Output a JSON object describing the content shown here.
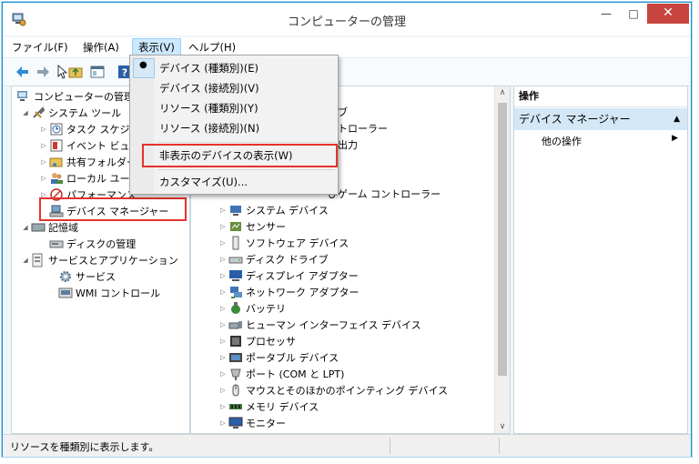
{
  "window": {
    "title": "コンピューターの管理"
  },
  "menubar": [
    {
      "label": "ファイル(F)"
    },
    {
      "label": "操作(A)"
    },
    {
      "label": "表示(V)"
    },
    {
      "label": "ヘルプ(H)"
    }
  ],
  "tree": {
    "root": "コンピューターの管理",
    "system_tools": "システム ツール",
    "task_scheduler": "タスク スケジュ",
    "event_viewer": "イベント ビュー",
    "shared_folders": "共有フォルダー",
    "local_users": "ローカル ユー",
    "performance": "パフォーマンス",
    "device_manager": "デバイス マネージャー",
    "storage": "記憶域",
    "disk_management": "ディスクの管理",
    "services_apps": "サービスとアプリケーション",
    "services": "サービス",
    "wmi": "WMI コントロール"
  },
  "devices": {
    "partial_1": "イブ",
    "partial_2": "ントローラー",
    "partial_3": "び出力",
    "partial_4": "びゲーム コントローラー",
    "items": [
      {
        "label": "システム デバイス"
      },
      {
        "label": "センサー"
      },
      {
        "label": "ソフトウェア デバイス"
      },
      {
        "label": "ディスク ドライブ"
      },
      {
        "label": "ディスプレイ アダプター"
      },
      {
        "label": "ネットワーク アダプター"
      },
      {
        "label": "バッテリ"
      },
      {
        "label": "ヒューマン インターフェイス デバイス"
      },
      {
        "label": "プロセッサ"
      },
      {
        "label": "ポータブル デバイス"
      },
      {
        "label": "ポート (COM と LPT)"
      },
      {
        "label": "マウスとそのほかのポインティング デバイス"
      },
      {
        "label": "メモリ デバイス"
      },
      {
        "label": "モニター"
      }
    ]
  },
  "actions": {
    "header": "操作",
    "section": "デバイス マネージャー",
    "other": "他の操作"
  },
  "view_menu": {
    "by_type": "デバイス (種類別)(E)",
    "by_connection": "デバイス (接続別)(V)",
    "res_by_type": "リソース (種類別)(Y)",
    "res_by_connection": "リソース (接続別)(N)",
    "show_hidden": "非表示のデバイスの表示(W)",
    "customize": "カスタマイズ(U)...",
    "bullet": "●"
  },
  "status": {
    "text": "リソースを種類別に表示します。"
  },
  "colors": {
    "highlight": "#e3332e",
    "accent": "#1c8fd3"
  }
}
